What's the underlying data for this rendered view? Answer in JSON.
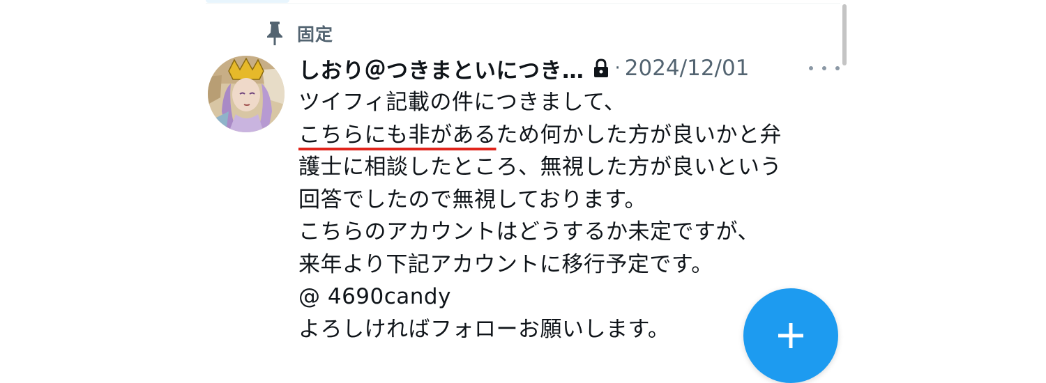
{
  "pinned": {
    "icon": "pin-icon",
    "label": "固定"
  },
  "tweet": {
    "author_name": "しおり＠つきまといにつき…",
    "protected_icon": "lock-icon",
    "separator": "·",
    "date": "2024/12/01",
    "more_icon": "more-horizontal-icon",
    "body": {
      "line1": "ツイフィ記載の件につきまして、",
      "line2_underlined": "こちらにも非がある",
      "line2_rest": "ため何かした方が良いかと弁",
      "line3": "護士に相談したところ、無視した方が良いという",
      "line4": "回答でしたので無視しております。",
      "line5": "こちらのアカウントはどうするか未定ですが、",
      "line6": "来年より下記アカウントに移行予定です。",
      "line7": "@ 4690candy",
      "line8": "よろしければフォローお願いします。"
    },
    "underline_color": "#e0241b"
  },
  "fab": {
    "icon": "plus-icon",
    "color": "#1d9bf0"
  },
  "colors": {
    "text_primary": "#0f1419",
    "text_secondary": "#536471",
    "accent": "#1d9bf0"
  }
}
